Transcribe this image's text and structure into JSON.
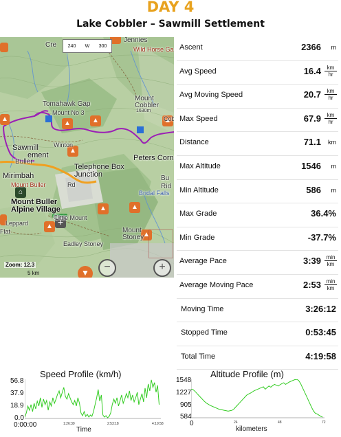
{
  "header": {
    "day": "DAY 4",
    "route": "Lake Cobbler – Sawmill Settlement"
  },
  "map": {
    "scale_left": "240",
    "scale_mid": "W",
    "scale_right": "300",
    "zoom": "Zoom: 12.3",
    "scale_km": "5 km",
    "labels": {
      "jennies": "Jennies",
      "cre": "Cre",
      "horse_ga": "Wild Horse Ga",
      "tomahawk": "Tomahawk Gap",
      "mount_no3": "Mount No 3",
      "mount_cobbler": "Mount",
      "cobbler": "Cobbler",
      "cobbler_alt": "1630m",
      "sawmill": "Sawmill",
      "settlement": "ement",
      "buller": "Buller",
      "winton": "Winton",
      "telephone_box": "Telephone Box",
      "junction": "Junction",
      "peters_corner": "Peters Corne",
      "mirimbah": "Mirimbah",
      "mount_buller_rd": "Mount Buller",
      "buller_alpine_1": "Mount Buller",
      "buller_alpine_2": "Alpine Village",
      "little_mount": "Little Mount",
      "mount_stoney": "Mount",
      "stoney": "Stoney",
      "rd": "Rd",
      "bridal_falls": "Bridal Falls",
      "flat": "Flat",
      "eadley": "Eadley Stoney",
      "clear": "Clear",
      "bu": "Bu",
      "rid": "Rid",
      "leppard": "Leppard",
      "cobbler_pin": "Cob"
    }
  },
  "stats": [
    {
      "label": "Ascent",
      "value": "2366",
      "unit": "m"
    },
    {
      "label": "Avg Speed",
      "value": "16.4",
      "unit_num": "km",
      "unit_den": "hr"
    },
    {
      "label": "Avg Moving Speed",
      "value": "20.7",
      "unit_num": "km",
      "unit_den": "hr"
    },
    {
      "label": "Max Speed",
      "value": "67.9",
      "unit_num": "km",
      "unit_den": "hr"
    },
    {
      "label": "Distance",
      "value": "71.1",
      "unit": "km"
    },
    {
      "label": "Max Altitude",
      "value": "1546",
      "unit": "m"
    },
    {
      "label": "Min Altitude",
      "value": "586",
      "unit": "m"
    },
    {
      "label": "Max Grade",
      "value": "36.4%"
    },
    {
      "label": "Min Grade",
      "value": "-37.7%"
    },
    {
      "label": "Average Pace",
      "value": "3:39",
      "unit_num": "min",
      "unit_den": "km"
    },
    {
      "label": "Average Moving Pace",
      "value": "2:53",
      "unit_num": "min",
      "unit_den": "km"
    },
    {
      "label": "Moving Time",
      "value": "3:26:12"
    },
    {
      "label": "Stopped Time",
      "value": "0:53:45"
    },
    {
      "label": "Total Time",
      "value": "4:19:58"
    }
  ],
  "colors": {
    "day": "#e8a21e",
    "route": "#9b1fb5",
    "route_alt": "#e8a21e",
    "chart_line": "#33cc22"
  },
  "chart_data": [
    {
      "type": "line",
      "title": "Speed Profile (km/h)",
      "xlabel": "Time",
      "ylabel": "",
      "y_ticks": [
        "56.8",
        "37.9",
        "18.9",
        "0.0"
      ],
      "x_ticks": [
        "0:00:00",
        "1:26:39",
        "2:53:18",
        "4:19:58"
      ],
      "ylim": [
        0,
        56.8
      ],
      "xlim": [
        0,
        4.333
      ],
      "series": [
        {
          "x": [
            0,
            0.05,
            0.1,
            0.15,
            0.2,
            0.25,
            0.3,
            0.35,
            0.4,
            0.45,
            0.5,
            0.55,
            0.6,
            0.65,
            0.7,
            0.75,
            0.8,
            0.85,
            0.9,
            0.95,
            1.0,
            1.05,
            1.1,
            1.15,
            1.2,
            1.25,
            1.3,
            1.35,
            1.4,
            1.45,
            1.5,
            1.55,
            1.6,
            1.65,
            1.7,
            1.75,
            1.8,
            1.85,
            1.9,
            1.95,
            2.0,
            2.05,
            2.1,
            2.15,
            2.2,
            2.25,
            2.3,
            2.35,
            2.4,
            2.45,
            2.5,
            2.55,
            2.6,
            2.65,
            2.7,
            2.75,
            2.8,
            2.85,
            2.9,
            2.95,
            3.0,
            3.05,
            3.1,
            3.15,
            3.2,
            3.25,
            3.3,
            3.35,
            3.4,
            3.45,
            3.5,
            3.55,
            3.6,
            3.65,
            3.7,
            3.75,
            3.8,
            3.85,
            3.9,
            3.95,
            4.0,
            4.05,
            4.1,
            4.15,
            4.2,
            4.25,
            4.3
          ],
          "y": [
            2,
            8,
            18,
            12,
            20,
            10,
            22,
            14,
            25,
            18,
            30,
            16,
            28,
            20,
            26,
            12,
            24,
            18,
            30,
            22,
            28,
            35,
            40,
            30,
            38,
            45,
            32,
            28,
            36,
            30,
            24,
            20,
            26,
            18,
            30,
            22,
            8,
            4,
            10,
            3,
            6,
            2,
            5,
            3,
            10,
            20,
            30,
            42,
            25,
            34,
            5,
            2,
            4,
            1,
            3,
            8,
            20,
            28,
            22,
            30,
            18,
            26,
            34,
            22,
            28,
            36,
            30,
            40,
            26,
            34,
            24,
            30,
            38,
            20,
            28,
            36,
            24,
            44,
            30,
            50,
            40,
            56,
            45,
            52,
            38,
            48,
            20
          ]
        }
      ]
    },
    {
      "type": "line",
      "title": "Altitude Profile (m)",
      "xlabel": "kilometers",
      "ylabel": "",
      "y_ticks": [
        "1548",
        "1227",
        "905",
        "584"
      ],
      "x_ticks": [
        "0",
        "24",
        "48",
        "72"
      ],
      "ylim": [
        584,
        1548
      ],
      "xlim": [
        0,
        72
      ],
      "series": [
        {
          "x": [
            0,
            1,
            2,
            3,
            4,
            5,
            6,
            7,
            8,
            9,
            10,
            11,
            12,
            13,
            14,
            15,
            16,
            17,
            18,
            19,
            20,
            21,
            22,
            23,
            24,
            25,
            26,
            27,
            28,
            29,
            30,
            31,
            32,
            33,
            34,
            35,
            36,
            37,
            38,
            39,
            40,
            41,
            42,
            43,
            44,
            45,
            46,
            47,
            48,
            49,
            50,
            51,
            52,
            53,
            54,
            55,
            56,
            57,
            58,
            59,
            60,
            61,
            62,
            63,
            64,
            65,
            66,
            67,
            68,
            69,
            70,
            71
          ],
          "y": [
            1300,
            1290,
            1250,
            1200,
            1150,
            1100,
            1050,
            1000,
            960,
            930,
            900,
            880,
            860,
            840,
            820,
            800,
            790,
            780,
            770,
            760,
            750,
            760,
            770,
            800,
            850,
            900,
            950,
            1000,
            1050,
            1100,
            1150,
            1180,
            1200,
            1230,
            1260,
            1280,
            1300,
            1320,
            1340,
            1360,
            1300,
            1340,
            1380,
            1350,
            1390,
            1420,
            1400,
            1380,
            1410,
            1440,
            1460,
            1420,
            1450,
            1480,
            1500,
            1520,
            1540,
            1546,
            1520,
            1450,
            1350,
            1250,
            1150,
            1050,
            950,
            850,
            760,
            700,
            680,
            650,
            620,
            600
          ]
        }
      ]
    }
  ]
}
